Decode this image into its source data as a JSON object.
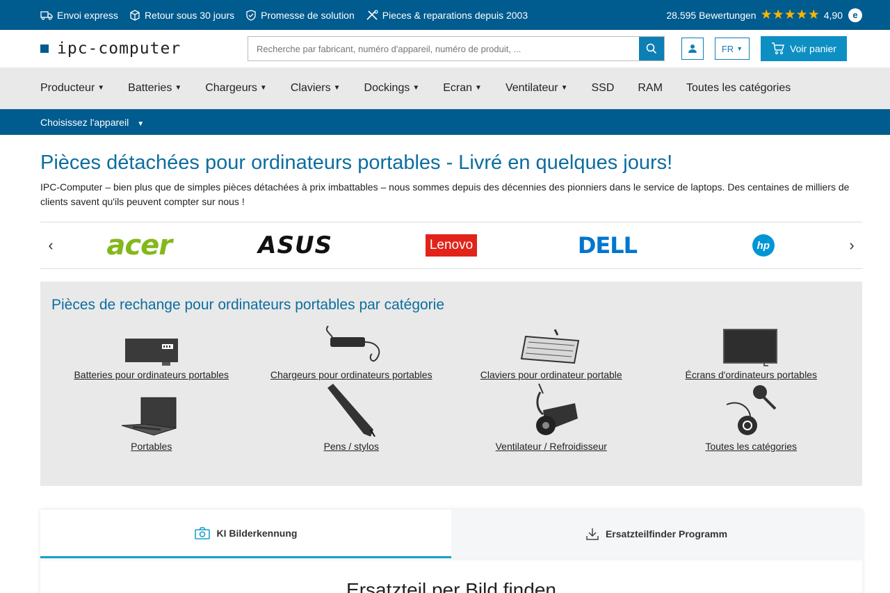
{
  "topbar": {
    "features": [
      {
        "icon": "truck-icon",
        "label": "Envoi express"
      },
      {
        "icon": "box-icon",
        "label": "Retour sous 30 jours"
      },
      {
        "icon": "shield-check-icon",
        "label": "Promesse de solution"
      },
      {
        "icon": "tools-icon",
        "label": "Pieces & reparations depuis 2003"
      }
    ],
    "rating_text": "28.595 Bewertungen",
    "stars": "★★★★★",
    "score": "4,90",
    "trust_badge": "e"
  },
  "header": {
    "logo_text": "ipc-computer",
    "search_placeholder": "Recherche par fabricant, numéro d'appareil, numéro de produit, ...",
    "lang": "FR",
    "cart_label": "Voir panier"
  },
  "nav": {
    "items": [
      {
        "label": "Producteur",
        "dropdown": true
      },
      {
        "label": "Batteries",
        "dropdown": true
      },
      {
        "label": "Chargeurs",
        "dropdown": true
      },
      {
        "label": "Claviers",
        "dropdown": true
      },
      {
        "label": "Dockings",
        "dropdown": true
      },
      {
        "label": "Ecran",
        "dropdown": true
      },
      {
        "label": "Ventilateur",
        "dropdown": true
      },
      {
        "label": "SSD",
        "dropdown": false
      },
      {
        "label": "RAM",
        "dropdown": false
      },
      {
        "label": "Toutes les catégories",
        "dropdown": false
      }
    ]
  },
  "subnav": {
    "label": "Choisissez l'appareil"
  },
  "main": {
    "title": "Pièces détachées pour ordinateurs portables - Livré en quelques jours!",
    "intro": "IPC-Computer – bien plus que de simples pièces détachées à prix imbattables – nous sommes depuis des décennies des pionniers dans le service de laptops. Des centaines de milliers de clients savent qu'ils peuvent compter sur nous !"
  },
  "brands": [
    "acer",
    "ASUS",
    "Lenovo",
    "DELL",
    "hp"
  ],
  "categories": {
    "title": "Pièces de rechange pour ordinateurs portables par catégorie",
    "items": [
      {
        "label": "Batteries pour ordinateurs portables",
        "icon": "battery-icon"
      },
      {
        "label": "Chargeurs pour ordinateurs portables",
        "icon": "charger-icon"
      },
      {
        "label": "Claviers pour ordinateur portable",
        "icon": "keyboard-icon"
      },
      {
        "label": "Écrans d'ordinateurs portables",
        "icon": "screen-icon"
      },
      {
        "label": "Portables",
        "icon": "laptop-icon"
      },
      {
        "label": "Pens / stylos",
        "icon": "pen-icon"
      },
      {
        "label": "Ventilateur / Refroidisseur",
        "icon": "fan-icon"
      },
      {
        "label": "Toutes les catégories",
        "icon": "all-parts-icon"
      }
    ]
  },
  "tabs": [
    {
      "label": "KI Bilderkennung",
      "icon": "camera-icon",
      "active": true
    },
    {
      "label": "Ersatzteilfinder Programm",
      "icon": "download-icon",
      "active": false
    }
  ],
  "tab_content": {
    "title": "Ersatzteil per Bild finden"
  },
  "colors": {
    "primary": "#005b8f",
    "accent": "#0e8fc4",
    "title": "#0c6d9f",
    "star": "#f7b500"
  }
}
